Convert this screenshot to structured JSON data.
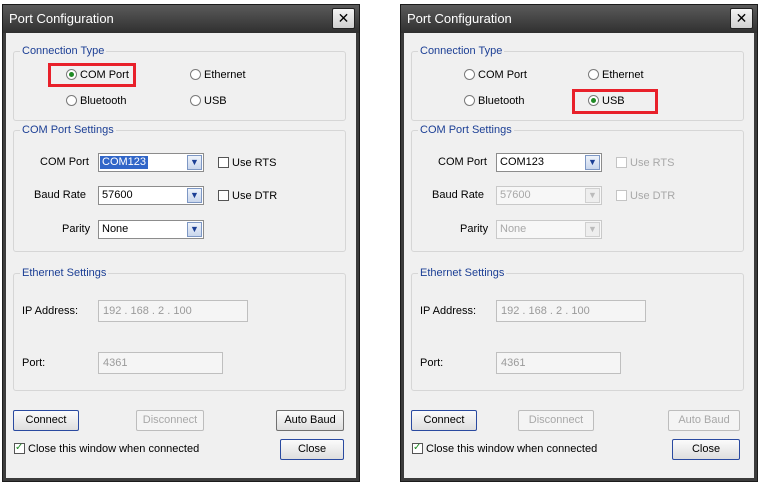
{
  "windows": [
    {
      "title": "Port Configuration",
      "close_glyph": "✕",
      "connection_type": {
        "legend": "Connection Type",
        "options": [
          "COM Port",
          "Ethernet",
          "Bluetooth",
          "USB"
        ],
        "selected": "COM Port"
      },
      "com_settings": {
        "legend": "COM Port Settings",
        "com_port_label": "COM Port",
        "com_port_value": "COM123",
        "baud_label": "Baud Rate",
        "baud_value": "57600",
        "parity_label": "Parity",
        "parity_value": "None",
        "use_rts": "Use RTS",
        "use_dtr": "Use DTR",
        "enabled": true
      },
      "ethernet": {
        "legend": "Ethernet Settings",
        "ip_label": "IP Address:",
        "ip_value": "192  .  168  .   2   .  100",
        "port_label": "Port:",
        "port_value": "4361"
      },
      "buttons": {
        "connect": "Connect",
        "disconnect": "Disconnect",
        "auto_baud": "Auto Baud",
        "close": "Close"
      },
      "close_on_connect": "Close this window when connected"
    },
    {
      "title": "Port Configuration",
      "close_glyph": "✕",
      "connection_type": {
        "legend": "Connection Type",
        "options": [
          "COM Port",
          "Ethernet",
          "Bluetooth",
          "USB"
        ],
        "selected": "USB"
      },
      "com_settings": {
        "legend": "COM Port Settings",
        "com_port_label": "COM Port",
        "com_port_value": "COM123",
        "baud_label": "Baud Rate",
        "baud_value": "57600",
        "parity_label": "Parity",
        "parity_value": "None",
        "use_rts": "Use RTS",
        "use_dtr": "Use DTR",
        "enabled": false
      },
      "ethernet": {
        "legend": "Ethernet Settings",
        "ip_label": "IP Address:",
        "ip_value": "192  .  168  .   2   .  100",
        "port_label": "Port:",
        "port_value": "4361"
      },
      "buttons": {
        "connect": "Connect",
        "disconnect": "Disconnect",
        "auto_baud": "Auto Baud",
        "close": "Close"
      },
      "close_on_connect": "Close this window when connected"
    }
  ],
  "highlight_color": "#e8202a"
}
